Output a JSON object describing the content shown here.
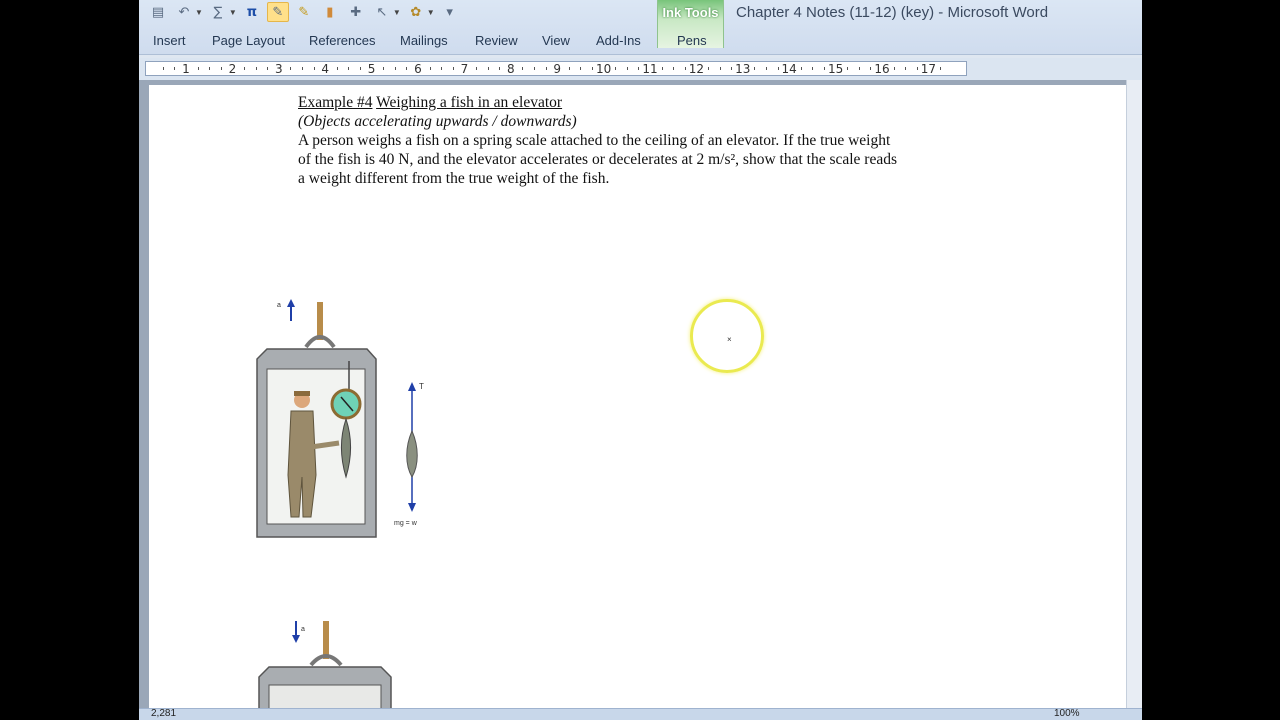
{
  "window": {
    "title": "Chapter 4 Notes (11-12) (key)  -  Microsoft Word"
  },
  "context_tab": {
    "group": "Ink Tools",
    "tab": "Pens"
  },
  "ribbon_tabs": [
    "Insert",
    "Page Layout",
    "References",
    "Mailings",
    "Review",
    "View",
    "Add-Ins"
  ],
  "ruler": {
    "numbers": [
      "1",
      "2",
      "3",
      "4",
      "5",
      "6",
      "7",
      "8",
      "9",
      "10",
      "11",
      "12",
      "13",
      "14",
      "15",
      "16",
      "17"
    ]
  },
  "document": {
    "example_label": "Example #4",
    "example_title": "Weighing a fish in an elevator",
    "subtitle": "(Objects accelerating upwards / downwards)",
    "body_line1": "A person weighs a fish on a spring scale attached to the ceiling of an elevator.  If the true weight",
    "body_line2": "of the fish is 40 N, and the elevator accelerates or decelerates at 2 m/s², show that the scale reads",
    "body_line3": "a weight different from the true weight of the fish.",
    "figure1": {
      "accel_label": "a",
      "tension_label": "T",
      "weight_label": "mg = w"
    },
    "figure2": {
      "accel_label": "a"
    }
  },
  "status": {
    "page_info": "2,281",
    "zoom": "100%"
  },
  "colors": {
    "context_tab": "#78c47a",
    "ink_cursor": "#eaea50",
    "vector": "#1f3fa8"
  }
}
